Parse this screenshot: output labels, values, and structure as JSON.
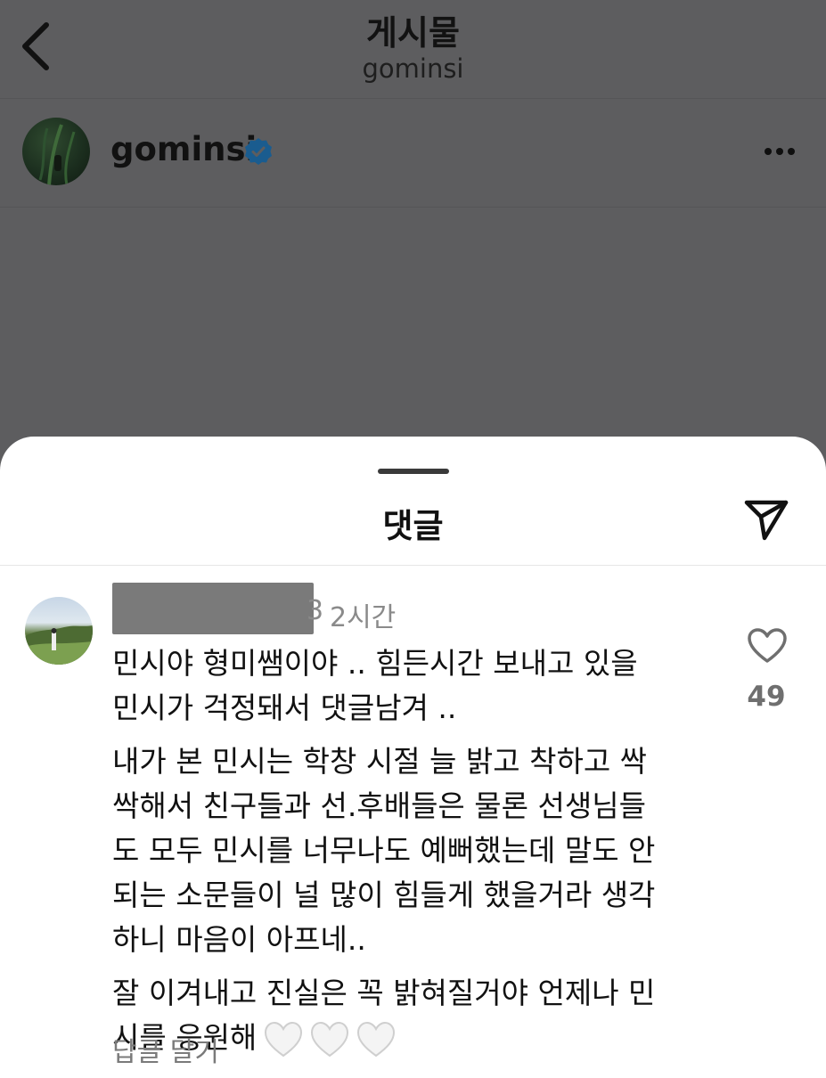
{
  "header": {
    "title": "게시물",
    "subtitle": "gominsi"
  },
  "post": {
    "username": "gominsi",
    "verified": true
  },
  "sheet": {
    "title": "댓글"
  },
  "comment": {
    "name_tail": "3",
    "time": "2시간",
    "paragraphs": [
      "민시야 형미쌤이야 .. 힘든시간 보내고 있을\n민시가 걱정돼서 댓글남겨 ..",
      "내가 본 민시는 학창 시절 늘 밝고 착하고 싹\n싹해서 친구들과 선.후배들은 물론 선생님들\n도 모두 민시를 너무나도 예뻐했는데 말도 안\n되는 소문들이 널 많이 힘들게 했을거라 생각\n하니 마음이 아프네..",
      "잘 이겨내고 진실은 꼭 밝혀질거야 언제나 민\n시를 응원해"
    ],
    "like_count": "49",
    "reply_label": "답글 달기"
  },
  "colors": {
    "verified_blue": "#0095f6",
    "overlay": "#5d5d5f",
    "sheet_bg": "#ffffff"
  },
  "icons": [
    "back-arrow-icon",
    "verified-badge-icon",
    "more-dots-icon",
    "share-paper-plane-icon",
    "heart-outline-icon",
    "white-heart-emoji"
  ]
}
